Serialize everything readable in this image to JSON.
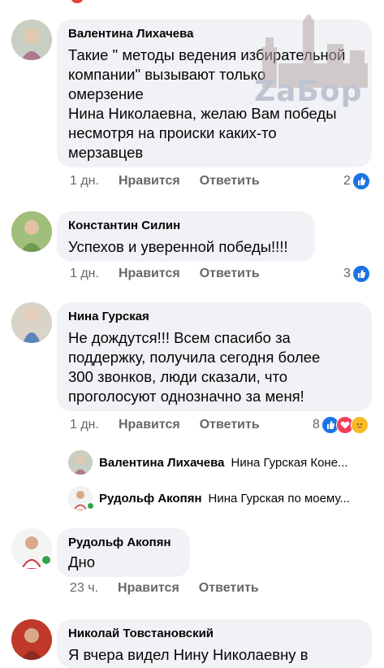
{
  "watermark": {
    "text": "ZaБор"
  },
  "comments": [
    {
      "author": "Валентина Лихачева",
      "text": "Такие \" методы ведения избирательной\nкомпании\"  вызывают только\nомерзение\nНина Николаевна, желаю Вам победы\nнесмотря на происки каких-то\nмерзавцев",
      "time": "1 дн.",
      "like": "Нравится",
      "reply": "Ответить",
      "reaction_count": "2"
    },
    {
      "author": "Константин Силин",
      "text": "Успехов и уверенной победы!!!!",
      "time": "1 дн.",
      "like": "Нравится",
      "reply": "Ответить",
      "reaction_count": "3"
    },
    {
      "author": "Нина Гурская",
      "text": "Не дождутся!!! Всем спасибо за\nподдержку, получила сегодня более\n300 звонков, люди сказали, что\nпроголосуют однозначно за меня!",
      "time": "1 дн.",
      "like": "Нравится",
      "reply": "Ответить",
      "reaction_count": "8"
    },
    {
      "author": "Рудольф Акопян",
      "text": "Дно",
      "time": "23 ч.",
      "like": "Нравится",
      "reply": "Ответить"
    },
    {
      "author": "Николай Товстановский",
      "text": "Я вчера видел Нину Николаевну в"
    }
  ],
  "replies": [
    {
      "author": "Валентина Лихачева",
      "text": "Нина Гурская Коне..."
    },
    {
      "author": "Рудольф Акопян",
      "text": "Нина Гурская по моему..."
    }
  ],
  "colors": {
    "bubble": "#f0f2f5",
    "like_blue": "#1b74e4",
    "love_red": "#f33e58",
    "online_green": "#31a24c",
    "muted": "#65676b"
  }
}
